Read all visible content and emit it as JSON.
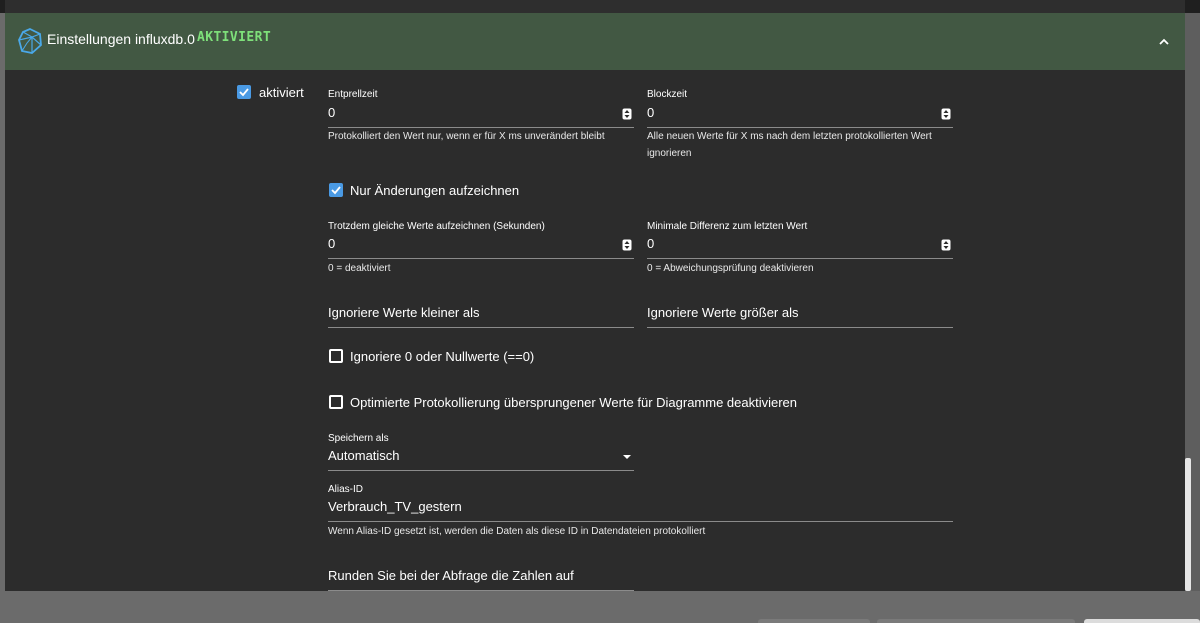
{
  "header": {
    "title": "Einstellungen influxdb.0",
    "status": "AKTIVIERT",
    "status_color": "#7ee07a",
    "icon": "influxdb-icon",
    "collapse_icon": "chevron-up-icon"
  },
  "enabled": {
    "label": "aktiviert",
    "checked": true
  },
  "debounce": {
    "label": "Entprellzeit",
    "value": "0",
    "helper": "Protokolliert den Wert nur, wenn er für X ms unverändert bleibt"
  },
  "blocktime": {
    "label": "Blockzeit",
    "value": "0",
    "helper_line1": "Alle neuen Werte für X ms nach dem letzten protokollierten Wert",
    "helper_line2": "ignorieren"
  },
  "changes_only": {
    "label": "Nur Änderungen aufzeichnen",
    "checked": true
  },
  "still_log": {
    "label": "Trotzdem gleiche Werte aufzeichnen (Sekunden)",
    "value": "0",
    "helper": "0 = deaktiviert"
  },
  "min_diff": {
    "label": "Minimale Differenz zum letzten Wert",
    "value": "0",
    "helper": "0 = Abweichungsprüfung deaktivieren"
  },
  "ignore_below": {
    "placeholder": "Ignoriere Werte kleiner als"
  },
  "ignore_above": {
    "placeholder": "Ignoriere Werte größer als"
  },
  "ignore_zero": {
    "label": "Ignoriere 0 oder Nullwerte (==0)",
    "checked": false
  },
  "disable_optimized": {
    "label": "Optimierte Protokollierung übersprungener Werte für Diagramme deaktivieren",
    "checked": false
  },
  "store_as": {
    "label": "Speichern als",
    "value": "Automatisch"
  },
  "alias": {
    "label": "Alias-ID",
    "value": "Verbrauch_TV_gestern",
    "helper": "Wenn Alias-ID gesetzt ist, werden die Daten als diese ID in Datendateien protokolliert"
  },
  "round": {
    "placeholder": "Runden Sie bei der Abfrage die Zahlen auf"
  },
  "colors": {
    "header_bg": "#425843",
    "panel_bg": "#2c2c2c",
    "checkbox": "#4a9ae4"
  }
}
